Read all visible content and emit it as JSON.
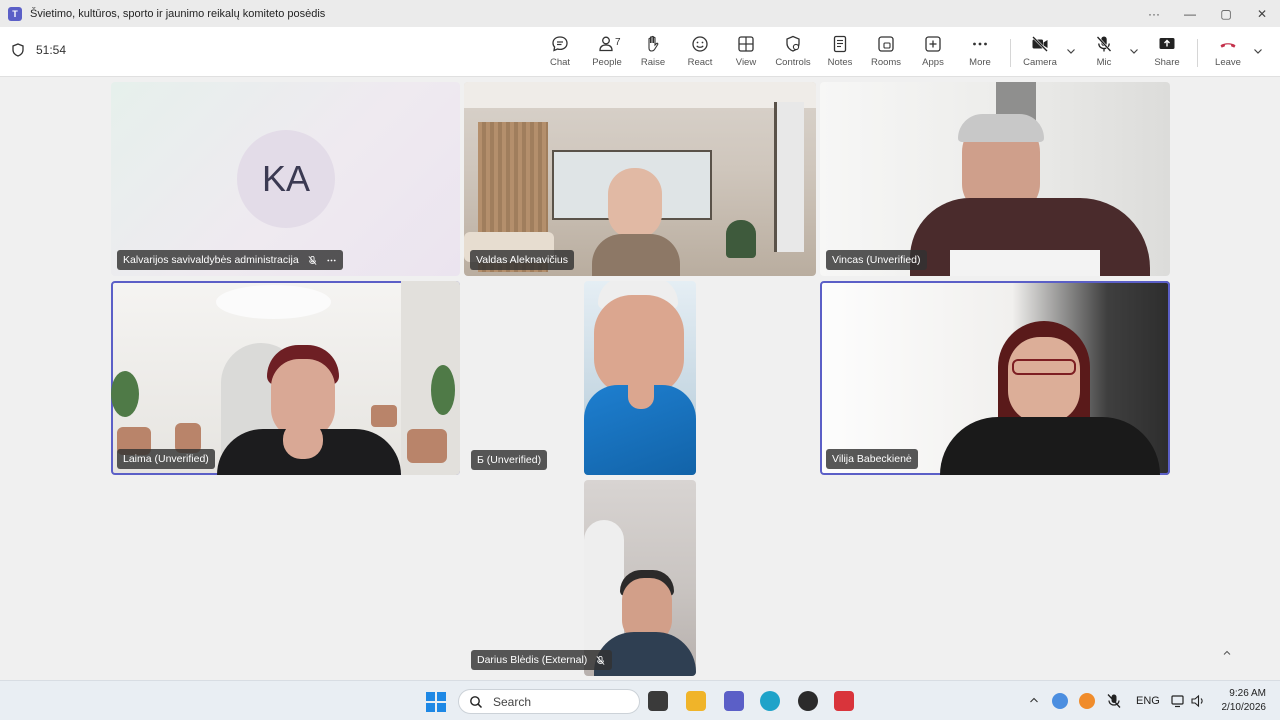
{
  "window": {
    "title": "Švietimo, kultūros, sporto ir jaunimo reikalų komiteto posėdis",
    "controls": [
      "···",
      "—",
      "▢",
      "✕"
    ]
  },
  "toolbar": {
    "timer": "51:54",
    "buttons": [
      {
        "label": "Chat"
      },
      {
        "label": "People",
        "count": "7"
      },
      {
        "label": "Raise"
      },
      {
        "label": "React"
      },
      {
        "label": "View"
      },
      {
        "label": "Controls"
      },
      {
        "label": "Notes"
      },
      {
        "label": "Rooms"
      },
      {
        "label": "Apps"
      },
      {
        "label": "More"
      },
      {
        "label": "Camera"
      },
      {
        "label": "Mic"
      },
      {
        "label": "Share"
      },
      {
        "label": "Leave"
      }
    ]
  },
  "participants": [
    {
      "name": "Kalvarijos savivaldybės administracija",
      "initials": "KA",
      "muted": true
    },
    {
      "name": "Valdas Aleknavičius"
    },
    {
      "name": "Vincas (Unverified)"
    },
    {
      "name": "Laima (Unverified)"
    },
    {
      "name": "Б (Unverified)"
    },
    {
      "name": "Vilija Babeckienė"
    },
    {
      "name": "Darius Blėdis (External)",
      "muted": true
    }
  ],
  "taskbar": {
    "search_placeholder": "Search",
    "language": "ENG",
    "time": "9:26 AM",
    "date": "2/10/2026"
  },
  "colors": {
    "accent": "#5b5fc7",
    "leave": "#c4314b"
  }
}
